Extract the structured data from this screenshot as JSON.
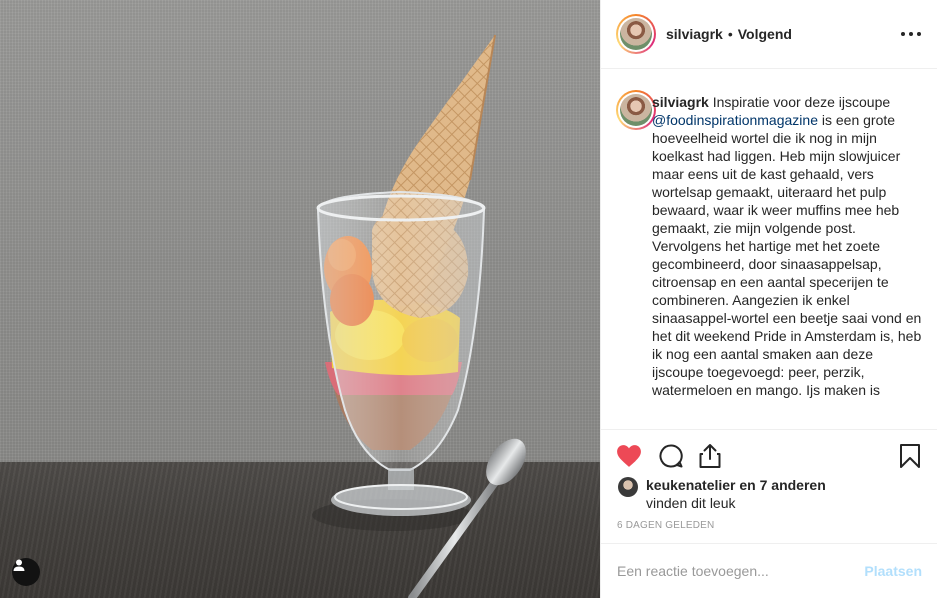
{
  "post": {
    "username": "silviagrk",
    "separator": "•",
    "follow_status": "Volgend",
    "caption": {
      "username": "silviagrk",
      "intro": " Inspiratie voor deze ijscoupe ",
      "mention": "@foodinspirationmagazine",
      "body": " is een grote hoeveelheid wortel die ik nog in mijn koelkast had liggen. Heb mijn slowjuicer maar eens uit de kast gehaald, vers wortelsap gemaakt, uiteraard het pulp bewaard, waar ik weer muffins mee heb gemaakt, zie mijn volgende post.\nVervolgens het hartige met het zoete gecombineerd, door sinaasappelsap, citroensap en een aantal specerijen te combineren. Aangezien ik enkel sinaasappel-wortel een beetje saai vond en het dit weekend Pride in Amsterdam is, heb ik nog een aantal smaken aan deze ijscoupe toegevoegd: peer, perzik, watermeloen en mango. Ijs maken is"
    },
    "likes": {
      "user": "keukenatelier",
      "rest": " en 7 anderen",
      "line2": "vinden dit leuk"
    },
    "timestamp": "6 DAGEN GELEDEN",
    "comment": {
      "placeholder": "Een reactie toevoegen...",
      "post_label": "Plaatsen"
    }
  },
  "icons": {
    "like": "heart-icon",
    "comment": "comment-icon",
    "share": "share-icon",
    "save": "bookmark-icon",
    "more": "more-options-icon",
    "tagged_user": "user-icon"
  },
  "colors": {
    "like": "#ed4956",
    "mention": "#003569",
    "post_button_disabled": "#b2dffc",
    "secondary_text": "#999999"
  }
}
